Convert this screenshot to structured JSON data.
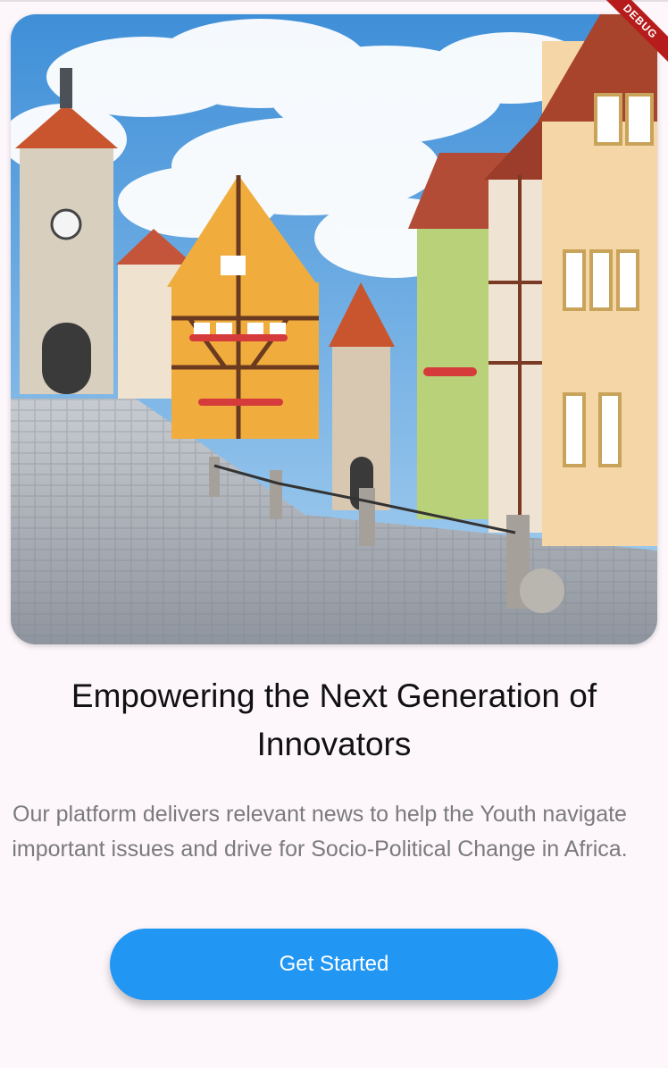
{
  "debug_banner": "DEBUG",
  "hero_image": {
    "description_icon": "town-street-photo"
  },
  "headline": "Empowering the Next Generation of Innovators",
  "description": "Our platform delivers relevant news to help the Youth navigate important issues and drive for Socio-Political Change in Africa.",
  "cta": {
    "label": "Get Started",
    "color": "#2196f3"
  },
  "colors": {
    "background": "#fdf7fb",
    "debug": "#b71c1c"
  }
}
